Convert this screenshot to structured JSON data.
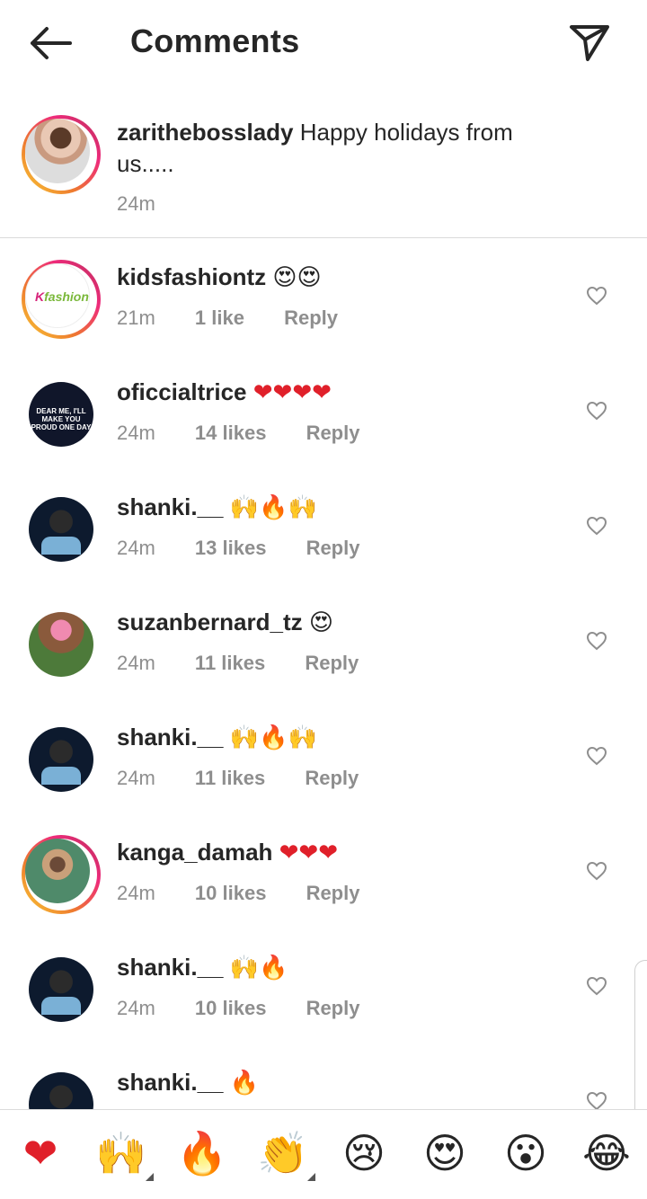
{
  "header": {
    "title": "Comments"
  },
  "caption": {
    "username": "zarithebosslady",
    "text": "Happy holidays from",
    "text_line2": "us.....",
    "time": "24m"
  },
  "comments": [
    {
      "username": "kidsfashiontz",
      "text": "😍😍",
      "time": "21m",
      "likes": "1 like",
      "reply": "Reply"
    },
    {
      "username": "oficcialtrice",
      "text": "❤❤❤❤",
      "time": "24m",
      "likes": "14 likes",
      "reply": "Reply",
      "avatar_text": "DEAR ME, I'LL MAKE YOU PROUD ONE DAY"
    },
    {
      "username": "shanki.__",
      "text": "🙌🔥🙌",
      "time": "24m",
      "likes": "13 likes",
      "reply": "Reply"
    },
    {
      "username": "suzanbernard_tz",
      "text": "😍",
      "time": "24m",
      "likes": "11 likes",
      "reply": "Reply"
    },
    {
      "username": "shanki.__",
      "text": "🙌🔥🙌",
      "time": "24m",
      "likes": "11 likes",
      "reply": "Reply"
    },
    {
      "username": "kanga_damah",
      "text": "❤❤❤",
      "time": "24m",
      "likes": "10 likes",
      "reply": "Reply"
    },
    {
      "username": "shanki.__",
      "text": "🙌🔥",
      "time": "24m",
      "likes": "10 likes",
      "reply": "Reply"
    },
    {
      "username": "shanki.__",
      "text": "🔥"
    }
  ],
  "emoji_bar": [
    "❤",
    "🙌",
    "🔥",
    "👏",
    "😢",
    "😍",
    "😮",
    "😂"
  ],
  "colors": {
    "text": "#262626",
    "meta": "#8e8e8e",
    "divider": "#dbdbdb",
    "heart_red": "#e0202a"
  }
}
